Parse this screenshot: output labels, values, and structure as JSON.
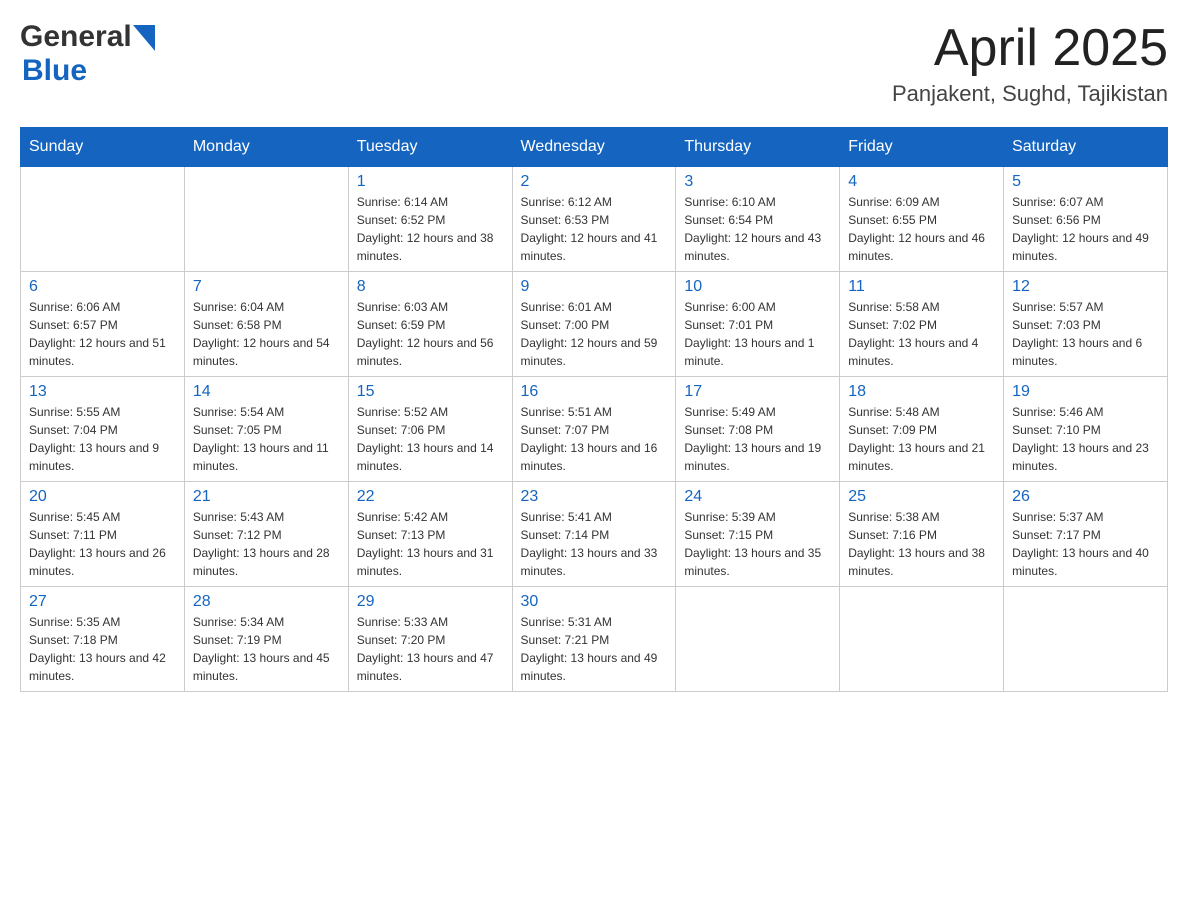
{
  "header": {
    "logo": {
      "general": "General",
      "blue": "Blue"
    },
    "month": "April 2025",
    "location": "Panjakent, Sughd, Tajikistan"
  },
  "days_of_week": [
    "Sunday",
    "Monday",
    "Tuesday",
    "Wednesday",
    "Thursday",
    "Friday",
    "Saturday"
  ],
  "weeks": [
    [
      {
        "day": "",
        "sunrise": "",
        "sunset": "",
        "daylight": ""
      },
      {
        "day": "",
        "sunrise": "",
        "sunset": "",
        "daylight": ""
      },
      {
        "day": "1",
        "sunrise": "Sunrise: 6:14 AM",
        "sunset": "Sunset: 6:52 PM",
        "daylight": "Daylight: 12 hours and 38 minutes."
      },
      {
        "day": "2",
        "sunrise": "Sunrise: 6:12 AM",
        "sunset": "Sunset: 6:53 PM",
        "daylight": "Daylight: 12 hours and 41 minutes."
      },
      {
        "day": "3",
        "sunrise": "Sunrise: 6:10 AM",
        "sunset": "Sunset: 6:54 PM",
        "daylight": "Daylight: 12 hours and 43 minutes."
      },
      {
        "day": "4",
        "sunrise": "Sunrise: 6:09 AM",
        "sunset": "Sunset: 6:55 PM",
        "daylight": "Daylight: 12 hours and 46 minutes."
      },
      {
        "day": "5",
        "sunrise": "Sunrise: 6:07 AM",
        "sunset": "Sunset: 6:56 PM",
        "daylight": "Daylight: 12 hours and 49 minutes."
      }
    ],
    [
      {
        "day": "6",
        "sunrise": "Sunrise: 6:06 AM",
        "sunset": "Sunset: 6:57 PM",
        "daylight": "Daylight: 12 hours and 51 minutes."
      },
      {
        "day": "7",
        "sunrise": "Sunrise: 6:04 AM",
        "sunset": "Sunset: 6:58 PM",
        "daylight": "Daylight: 12 hours and 54 minutes."
      },
      {
        "day": "8",
        "sunrise": "Sunrise: 6:03 AM",
        "sunset": "Sunset: 6:59 PM",
        "daylight": "Daylight: 12 hours and 56 minutes."
      },
      {
        "day": "9",
        "sunrise": "Sunrise: 6:01 AM",
        "sunset": "Sunset: 7:00 PM",
        "daylight": "Daylight: 12 hours and 59 minutes."
      },
      {
        "day": "10",
        "sunrise": "Sunrise: 6:00 AM",
        "sunset": "Sunset: 7:01 PM",
        "daylight": "Daylight: 13 hours and 1 minute."
      },
      {
        "day": "11",
        "sunrise": "Sunrise: 5:58 AM",
        "sunset": "Sunset: 7:02 PM",
        "daylight": "Daylight: 13 hours and 4 minutes."
      },
      {
        "day": "12",
        "sunrise": "Sunrise: 5:57 AM",
        "sunset": "Sunset: 7:03 PM",
        "daylight": "Daylight: 13 hours and 6 minutes."
      }
    ],
    [
      {
        "day": "13",
        "sunrise": "Sunrise: 5:55 AM",
        "sunset": "Sunset: 7:04 PM",
        "daylight": "Daylight: 13 hours and 9 minutes."
      },
      {
        "day": "14",
        "sunrise": "Sunrise: 5:54 AM",
        "sunset": "Sunset: 7:05 PM",
        "daylight": "Daylight: 13 hours and 11 minutes."
      },
      {
        "day": "15",
        "sunrise": "Sunrise: 5:52 AM",
        "sunset": "Sunset: 7:06 PM",
        "daylight": "Daylight: 13 hours and 14 minutes."
      },
      {
        "day": "16",
        "sunrise": "Sunrise: 5:51 AM",
        "sunset": "Sunset: 7:07 PM",
        "daylight": "Daylight: 13 hours and 16 minutes."
      },
      {
        "day": "17",
        "sunrise": "Sunrise: 5:49 AM",
        "sunset": "Sunset: 7:08 PM",
        "daylight": "Daylight: 13 hours and 19 minutes."
      },
      {
        "day": "18",
        "sunrise": "Sunrise: 5:48 AM",
        "sunset": "Sunset: 7:09 PM",
        "daylight": "Daylight: 13 hours and 21 minutes."
      },
      {
        "day": "19",
        "sunrise": "Sunrise: 5:46 AM",
        "sunset": "Sunset: 7:10 PM",
        "daylight": "Daylight: 13 hours and 23 minutes."
      }
    ],
    [
      {
        "day": "20",
        "sunrise": "Sunrise: 5:45 AM",
        "sunset": "Sunset: 7:11 PM",
        "daylight": "Daylight: 13 hours and 26 minutes."
      },
      {
        "day": "21",
        "sunrise": "Sunrise: 5:43 AM",
        "sunset": "Sunset: 7:12 PM",
        "daylight": "Daylight: 13 hours and 28 minutes."
      },
      {
        "day": "22",
        "sunrise": "Sunrise: 5:42 AM",
        "sunset": "Sunset: 7:13 PM",
        "daylight": "Daylight: 13 hours and 31 minutes."
      },
      {
        "day": "23",
        "sunrise": "Sunrise: 5:41 AM",
        "sunset": "Sunset: 7:14 PM",
        "daylight": "Daylight: 13 hours and 33 minutes."
      },
      {
        "day": "24",
        "sunrise": "Sunrise: 5:39 AM",
        "sunset": "Sunset: 7:15 PM",
        "daylight": "Daylight: 13 hours and 35 minutes."
      },
      {
        "day": "25",
        "sunrise": "Sunrise: 5:38 AM",
        "sunset": "Sunset: 7:16 PM",
        "daylight": "Daylight: 13 hours and 38 minutes."
      },
      {
        "day": "26",
        "sunrise": "Sunrise: 5:37 AM",
        "sunset": "Sunset: 7:17 PM",
        "daylight": "Daylight: 13 hours and 40 minutes."
      }
    ],
    [
      {
        "day": "27",
        "sunrise": "Sunrise: 5:35 AM",
        "sunset": "Sunset: 7:18 PM",
        "daylight": "Daylight: 13 hours and 42 minutes."
      },
      {
        "day": "28",
        "sunrise": "Sunrise: 5:34 AM",
        "sunset": "Sunset: 7:19 PM",
        "daylight": "Daylight: 13 hours and 45 minutes."
      },
      {
        "day": "29",
        "sunrise": "Sunrise: 5:33 AM",
        "sunset": "Sunset: 7:20 PM",
        "daylight": "Daylight: 13 hours and 47 minutes."
      },
      {
        "day": "30",
        "sunrise": "Sunrise: 5:31 AM",
        "sunset": "Sunset: 7:21 PM",
        "daylight": "Daylight: 13 hours and 49 minutes."
      },
      {
        "day": "",
        "sunrise": "",
        "sunset": "",
        "daylight": ""
      },
      {
        "day": "",
        "sunrise": "",
        "sunset": "",
        "daylight": ""
      },
      {
        "day": "",
        "sunrise": "",
        "sunset": "",
        "daylight": ""
      }
    ]
  ]
}
